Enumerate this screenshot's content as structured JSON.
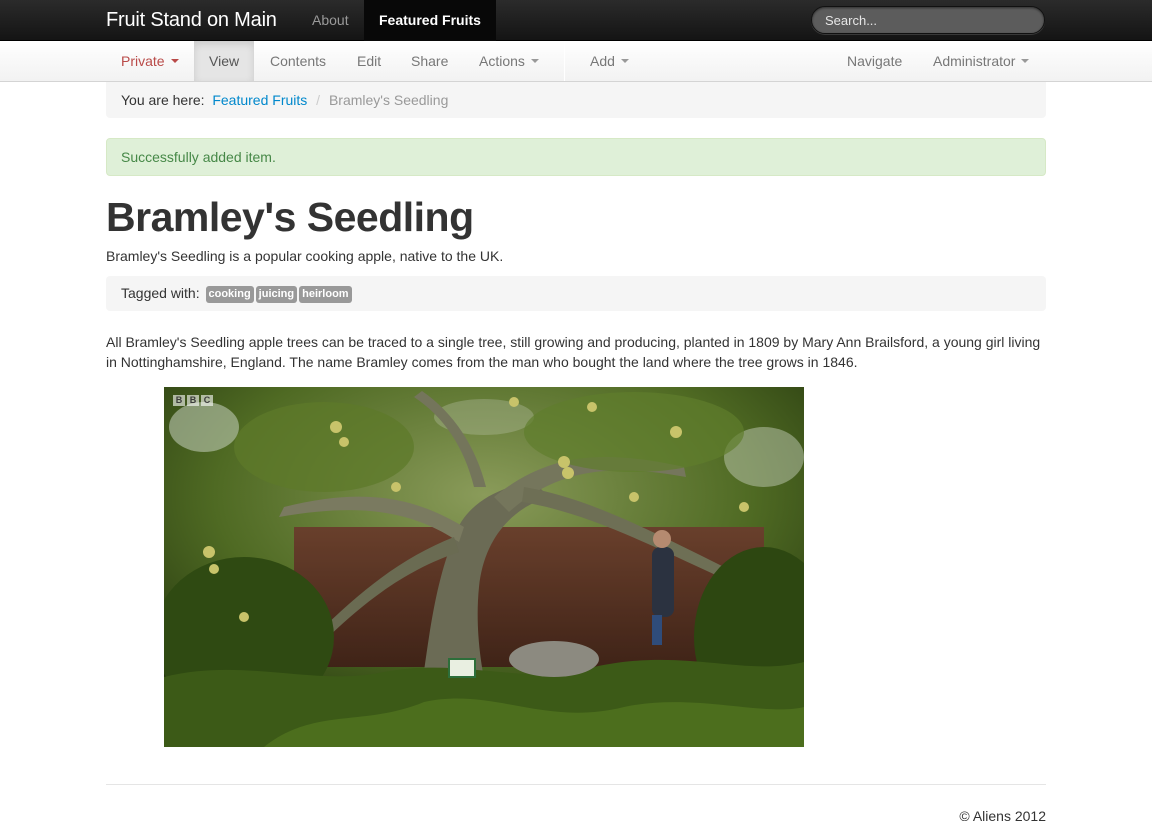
{
  "topbar": {
    "brand": "Fruit Stand on Main",
    "nav": [
      "About",
      "Featured Fruits"
    ],
    "search_placeholder": "Search..."
  },
  "editbar": {
    "state": "Private",
    "view": "View",
    "contents": "Contents",
    "edit": "Edit",
    "share": "Share",
    "actions": "Actions",
    "add": "Add",
    "navigate": "Navigate",
    "user": "Administrator"
  },
  "breadcrumb": {
    "prefix": "You are here:",
    "parent": "Featured Fruits",
    "separator": "/",
    "current": "Bramley's Seedling"
  },
  "alert": "Successfully added item.",
  "page": {
    "title": "Bramley's Seedling",
    "description": "Bramley's Seedling is a popular cooking apple, native to the UK.",
    "tags_label": "Tagged with:",
    "tags": [
      "cooking",
      "juicing",
      "heirloom"
    ],
    "body": "All Bramley's Seedling apple trees can be traced to a single tree, still growing and producing, planted in 1809 by Mary Ann Brailsford, a young girl living in Nottinghamshire, England. The name Bramley comes from the man who bought the land where the tree grows in 1846."
  },
  "image": {
    "watermark": [
      "B",
      "B",
      "C"
    ]
  },
  "footer": "© Aliens 2012",
  "colors": {
    "link": "#0088cc",
    "private": "#b94a48",
    "alert_bg": "#dff0d8",
    "alert_text": "#468847",
    "tag_bg": "#999999"
  }
}
